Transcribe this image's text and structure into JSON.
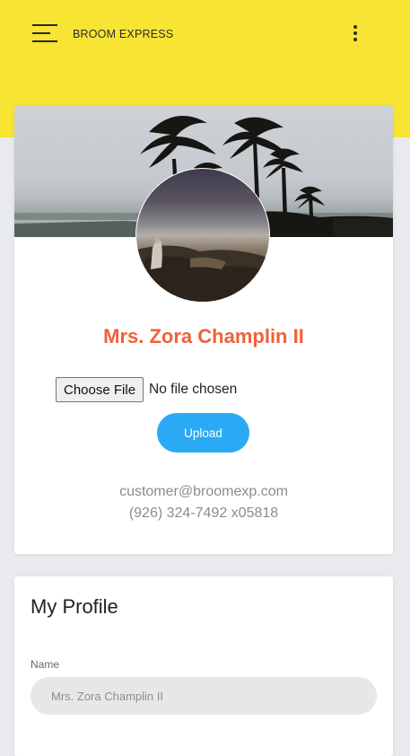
{
  "header": {
    "brand": "BROOM EXPRESS",
    "menu_icon": "hamburger-menu-icon",
    "more_icon": "more-vertical-icon",
    "color": "#f8e433"
  },
  "profile": {
    "name": "Mrs. Zora Champlin II",
    "name_color": "#f0613a",
    "file_button_label": "Choose File",
    "file_status": "No file chosen",
    "upload_label": "Upload",
    "upload_color": "#2aaaf5",
    "email": "customer@broomexp.com",
    "phone": "(926) 324-7492 x05818"
  },
  "my_profile": {
    "title": "My Profile",
    "name_label": "Name",
    "name_value": "Mrs. Zora Champlin II"
  }
}
